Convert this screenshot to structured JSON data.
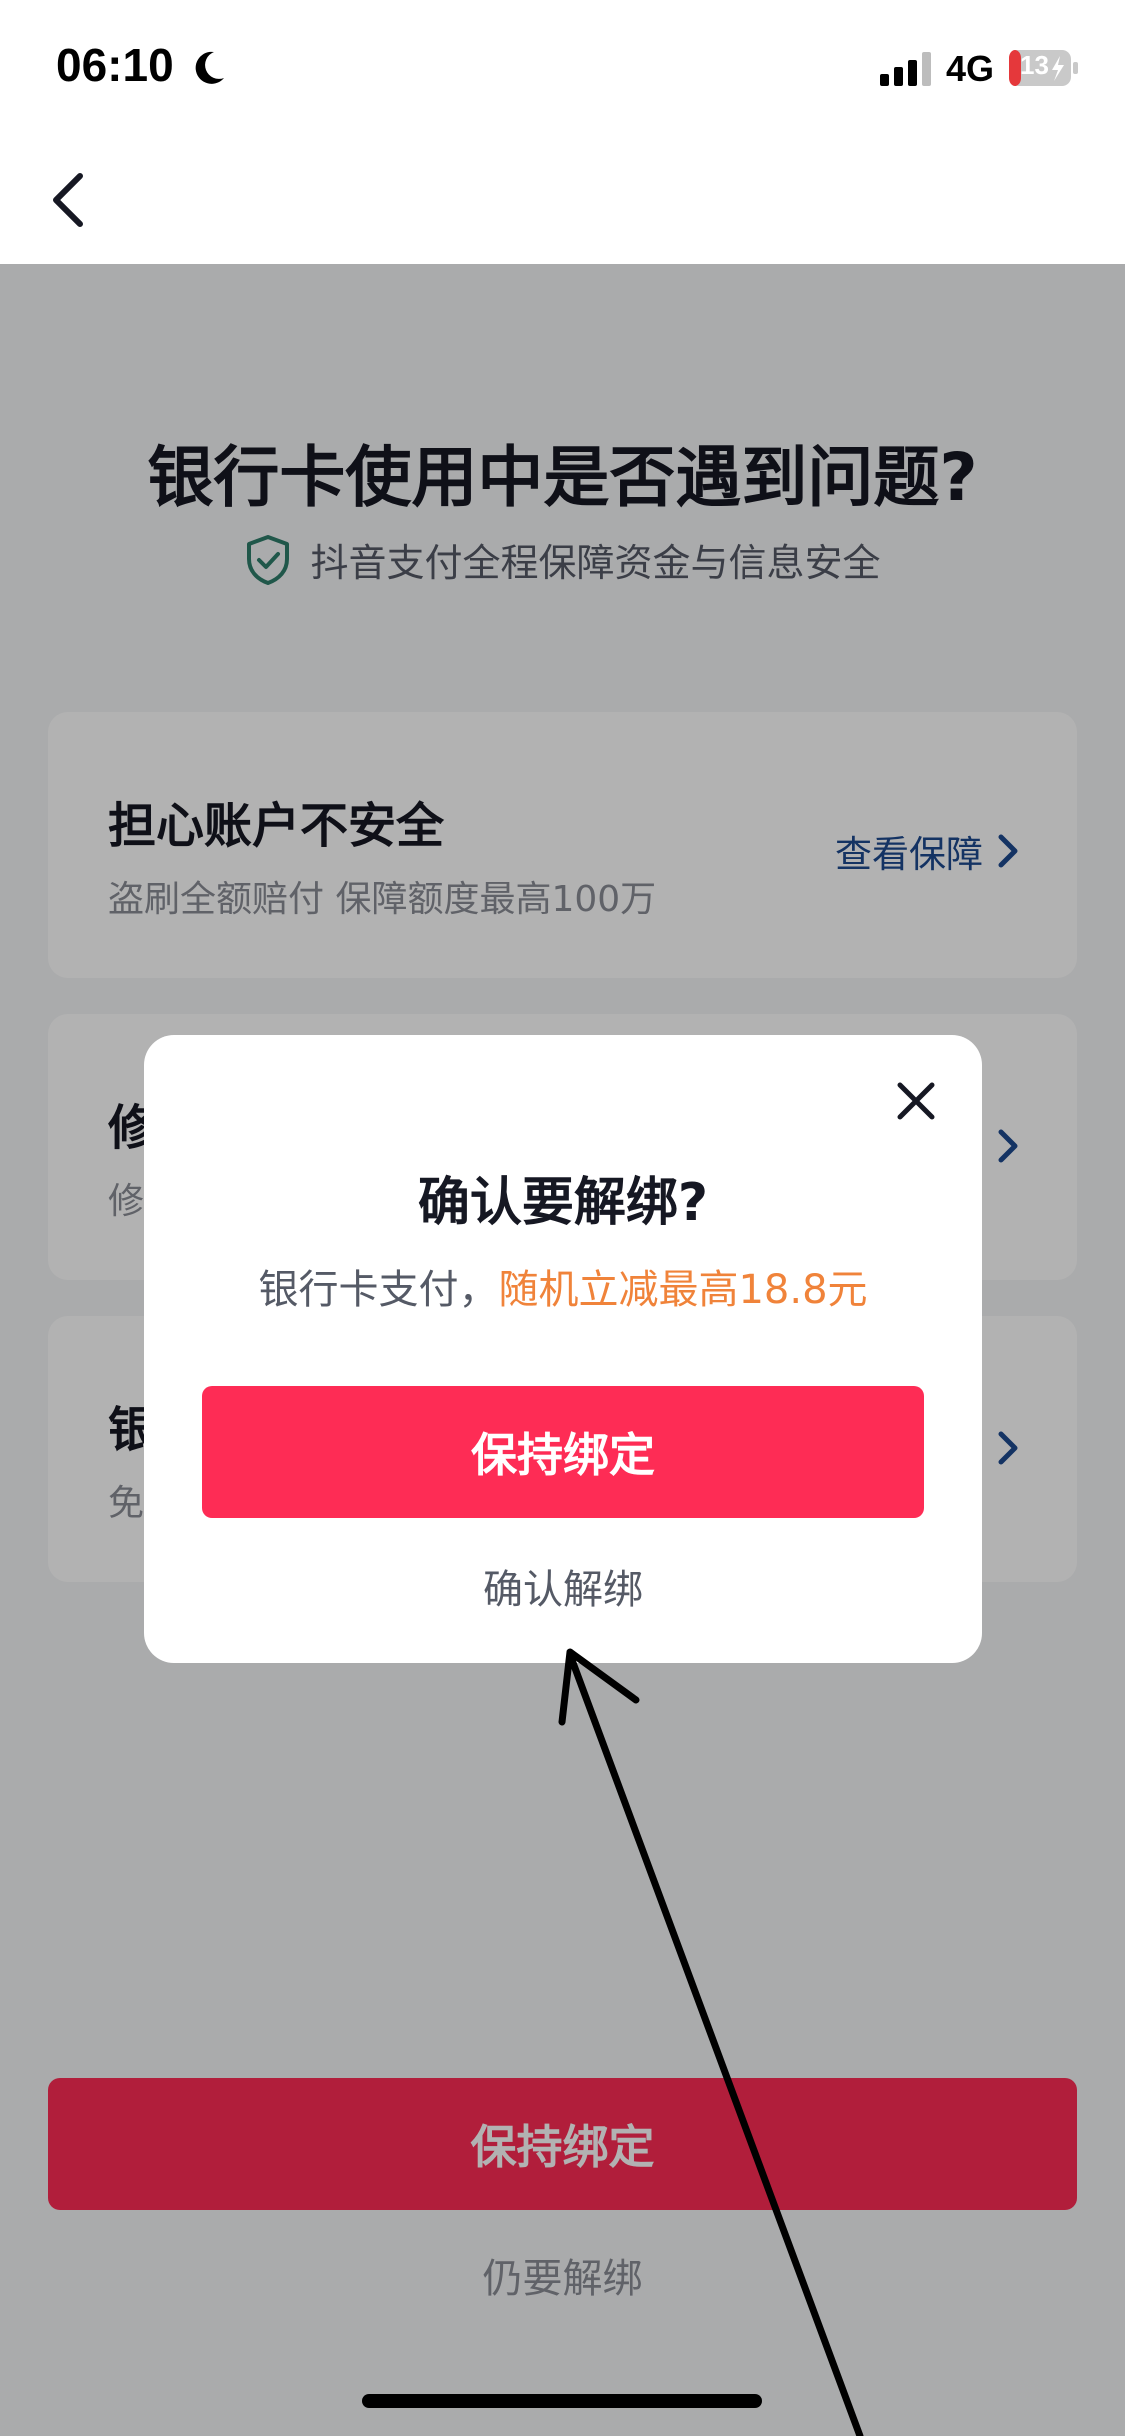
{
  "status_bar": {
    "time": "06:10",
    "network": "4G",
    "battery": "13",
    "icons": [
      "moon-icon",
      "signal-icon",
      "battery-charging-icon"
    ]
  },
  "nav": {
    "back_icon": "chevron-left-icon"
  },
  "page": {
    "title": "银行卡使用中是否遇到问题?",
    "subtitle": "抖音支付全程保障资金与信息安全",
    "shield_icon": "shield-check-icon",
    "cards": [
      {
        "title": "担心账户不安全",
        "desc": "盗刷全额赔付 保障额度最高100万",
        "link": "查看保障"
      },
      {
        "title": "修",
        "desc": "修",
        "link": ""
      },
      {
        "title": "银",
        "desc": "免",
        "link": ""
      }
    ],
    "primary_button": "保持绑定",
    "secondary_link": "仍要解绑"
  },
  "dialog": {
    "title": "确认要解绑?",
    "desc_prefix": "银行卡支付，",
    "desc_accent": "随机立减最高18.8元",
    "primary_button": "保持绑定",
    "secondary_button": "确认解绑",
    "close_icon": "close-icon"
  },
  "colors": {
    "brand": "#fe2c55",
    "accent_orange": "#f0833a",
    "link_blue": "#1d4a8f",
    "shield_green": "#2e7d6b"
  }
}
